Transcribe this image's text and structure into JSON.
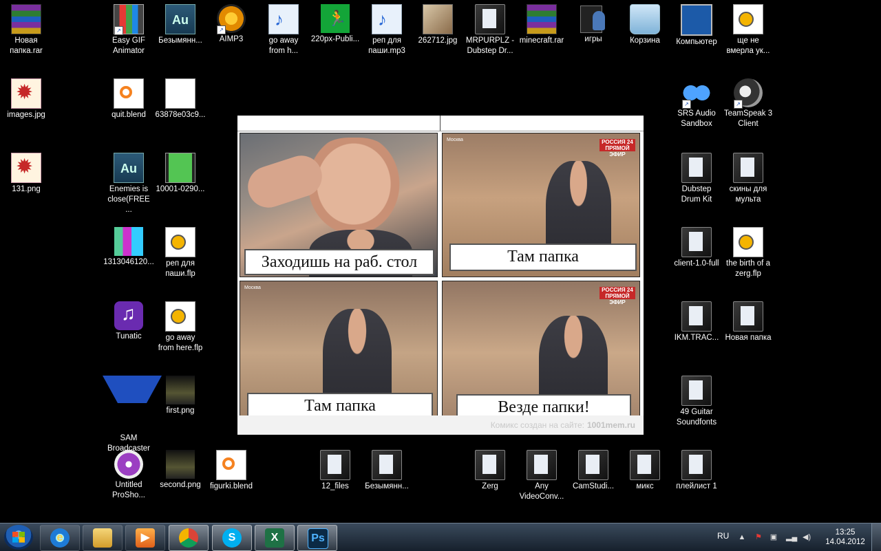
{
  "desktop": {
    "icons": [
      {
        "id": "novaya-papka-rar",
        "label": "Новая\nпапка.rar"
      },
      {
        "id": "easy-gif",
        "label": "Easy GIF\nAnimator"
      },
      {
        "id": "bezymyan-ses-1",
        "label": "Безымянн..."
      },
      {
        "id": "aimp3",
        "label": "AIMP3"
      },
      {
        "id": "go-away-mp3",
        "label": "go away\nfrom h..."
      },
      {
        "id": "public-220px",
        "label": "220px-Publi..."
      },
      {
        "id": "rep-mp3",
        "label": "реп для\nпаши.mp3"
      },
      {
        "id": "img-262712",
        "label": "262712.jpg"
      },
      {
        "id": "mrpurplz",
        "label": "MRPURPLZ -\nDubstep Dr..."
      },
      {
        "id": "minecraft-rar",
        "label": "minecraft.rar"
      },
      {
        "id": "igry",
        "label": "игры"
      },
      {
        "id": "korzina",
        "label": "Корзина"
      },
      {
        "id": "kompyuter",
        "label": "Компьютер"
      },
      {
        "id": "esche-ne",
        "label": "ще не\nвмерла ук..."
      },
      {
        "id": "images-jpg",
        "label": "images.jpg"
      },
      {
        "id": "quit-blend",
        "label": "quit.blend"
      },
      {
        "id": "file-63878",
        "label": "63878e03c9..."
      },
      {
        "id": "srs-audio",
        "label": "SRS Audio\nSandbox"
      },
      {
        "id": "teamspeak",
        "label": "TeamSpeak 3\nClient"
      },
      {
        "id": "png-131",
        "label": "131.png"
      },
      {
        "id": "enemies-ses",
        "label": "Enemies is\nclose(FREE ..."
      },
      {
        "id": "video-10001",
        "label": "10001-0290..."
      },
      {
        "id": "dubstep-kit",
        "label": "Dubstep\nDrum Kit"
      },
      {
        "id": "skiny",
        "label": "скины для\nмульта"
      },
      {
        "id": "file-1313",
        "label": "1313046120..."
      },
      {
        "id": "rep-flp",
        "label": "реп для\nпаши.flp"
      },
      {
        "id": "client-full",
        "label": "client-1.0-full"
      },
      {
        "id": "birth-zerg",
        "label": "the birth of a\nzerg.flp"
      },
      {
        "id": "tunatic",
        "label": "Tunatic"
      },
      {
        "id": "go-away-flp",
        "label": "go away\nfrom here.flp"
      },
      {
        "id": "ikm-trac",
        "label": "IKM.TRAC..."
      },
      {
        "id": "novaya-papka",
        "label": "Новая папка"
      },
      {
        "id": "sam",
        "label": "SAM\nBroadcaster"
      },
      {
        "id": "first-png",
        "label": "first.png"
      },
      {
        "id": "guitar-sf",
        "label": "49 Guitar\nSoundfonts"
      },
      {
        "id": "untitled-prosho",
        "label": "Untitled\nProSho..."
      },
      {
        "id": "second-png",
        "label": "second.png"
      },
      {
        "id": "figurki-blend",
        "label": "figurki.blend"
      },
      {
        "id": "files-12",
        "label": "12_files"
      },
      {
        "id": "bezymyan-2",
        "label": "Безымянн..."
      },
      {
        "id": "zerg",
        "label": "Zerg"
      },
      {
        "id": "any-video",
        "label": "Any\nVideoConv..."
      },
      {
        "id": "camstudio",
        "label": "CamStudi..."
      },
      {
        "id": "miks",
        "label": "микс"
      },
      {
        "id": "pleylist",
        "label": "плейлист 1"
      }
    ]
  },
  "comic": {
    "captions": [
      "Заходишь на раб. стол",
      "Там папка",
      "Там папка",
      "Везде папки!"
    ],
    "tv_channel": "Москва",
    "tv_badge": "РОССИЯ 24\nПРЯМОЙ ЭФИР",
    "footer_text": "Комикс создан на сайте:",
    "footer_site": "1001mem.ru"
  },
  "taskbar": {
    "pinned": [
      {
        "id": "ie",
        "glyph": "e"
      },
      {
        "id": "explorer",
        "glyph": ""
      },
      {
        "id": "media-player",
        "glyph": "▶"
      },
      {
        "id": "chrome",
        "glyph": ""
      },
      {
        "id": "skype",
        "glyph": "S"
      },
      {
        "id": "excel",
        "glyph": "X"
      },
      {
        "id": "photoshop",
        "glyph": "Ps"
      }
    ],
    "language": "RU",
    "time": "13:25",
    "date": "14.04.2012"
  },
  "colors": {
    "taskbar_top": "#3a4a5c",
    "taskbar_bottom": "#16202c",
    "desktop_bg": "#000000"
  }
}
